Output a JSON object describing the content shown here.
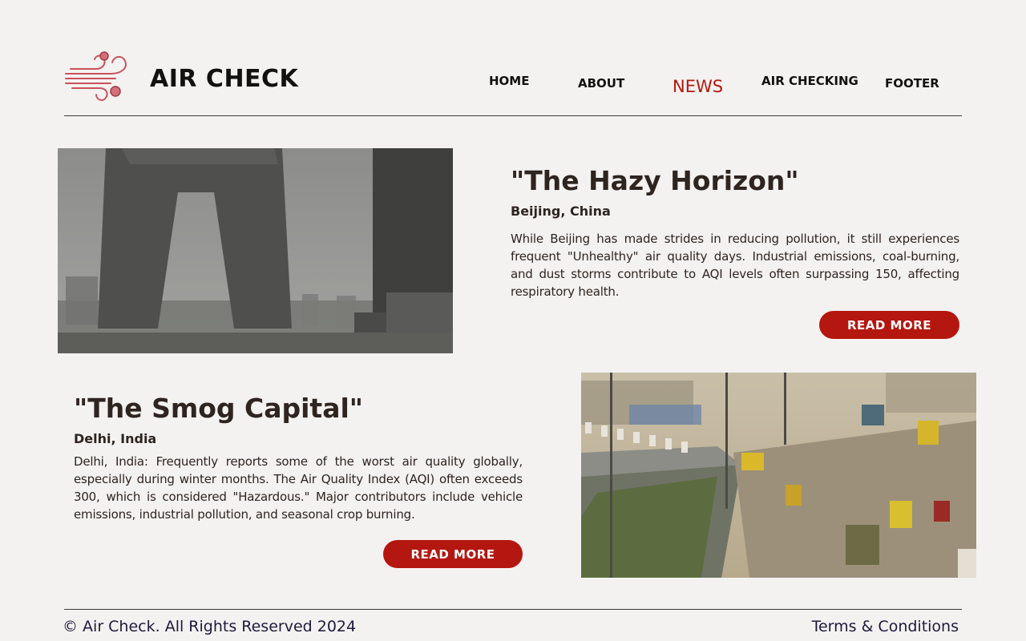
{
  "header": {
    "logo_icon": "wind-icon",
    "brand": "AIR CHECK",
    "nav": [
      {
        "label": "HOME"
      },
      {
        "label": "ABOUT"
      },
      {
        "label": "NEWS",
        "active": true
      },
      {
        "label": "AIR CHECKING"
      },
      {
        "label": "FOOTER"
      }
    ]
  },
  "articles": [
    {
      "title": "\"The Hazy Horizon\"",
      "location": "Beijing, China",
      "body": "While Beijing has made strides in reducing pollution, it still experiences frequent \"Unhealthy\" air quality days. Industrial emissions, coal-burning, and dust storms contribute to AQI levels often surpassing 150, affecting respiratory health.",
      "button": "READ MORE"
    },
    {
      "title": "\"The Smog Capital\"",
      "location": "Delhi, India",
      "body": "Delhi, India: Frequently reports some of the worst air quality globally, especially during winter months. The Air Quality Index (AQI) often exceeds 300, which is considered \"Hazardous.\" Major contributors include vehicle emissions, industrial pollution, and seasonal crop burning.",
      "button": "READ MORE"
    }
  ],
  "footer": {
    "copyright": "© Air Check. All Rights Reserved 2024",
    "terms": "Terms & Conditions"
  },
  "colors": {
    "accent": "#b4170f",
    "background": "#f4f2f0",
    "logo_pink": "#c9525c"
  }
}
